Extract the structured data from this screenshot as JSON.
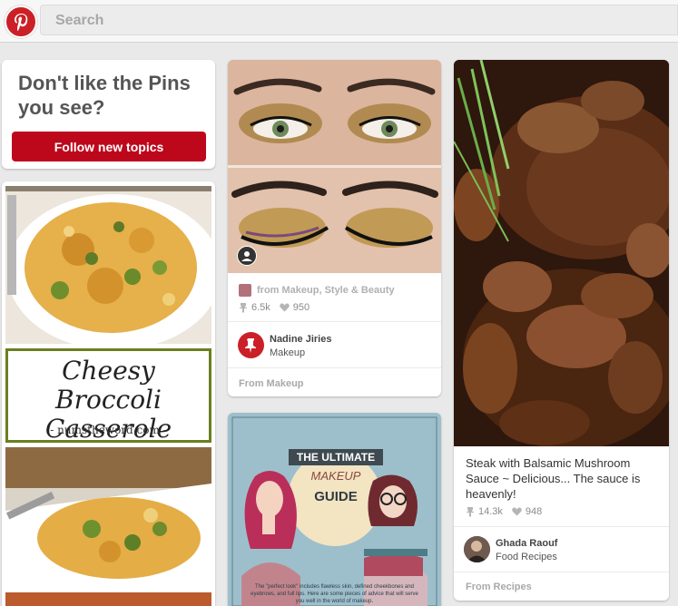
{
  "search": {
    "placeholder": "Search"
  },
  "topics_card": {
    "title": "Don't like the Pins you see?",
    "button": "Follow new topics"
  },
  "casserole_pin": {
    "line1": "Cheesy Broccoli",
    "line2": "Casserole",
    "site": "- numstheword.com -"
  },
  "makeup_pin": {
    "source": "from Makeup, Style & Beauty",
    "repins": "6.5k",
    "likes": "950",
    "user": "Nadine Jiries",
    "board": "Makeup",
    "from": "From Makeup"
  },
  "guide_pin": {
    "title_top": "THE ULTIMATE",
    "title_mid": "MAKEUP",
    "title_bottom": "GUIDE",
    "caption": "The \"perfect look\" includes flawless skin, defined cheekbones and eyebrows, and full lips. Here are some pieces of advice that will serve you well in the world of makeup."
  },
  "steak_pin": {
    "description": "Steak with Balsamic Mushroom Sauce ~ Delicious... The sauce is heavenly!",
    "repins": "14.3k",
    "likes": "948",
    "user": "Ghada Raouf",
    "board": "Food Recipes",
    "from": "From Recipes"
  },
  "colors": {
    "brand": "#bd081c",
    "background": "#e9e9e9"
  }
}
